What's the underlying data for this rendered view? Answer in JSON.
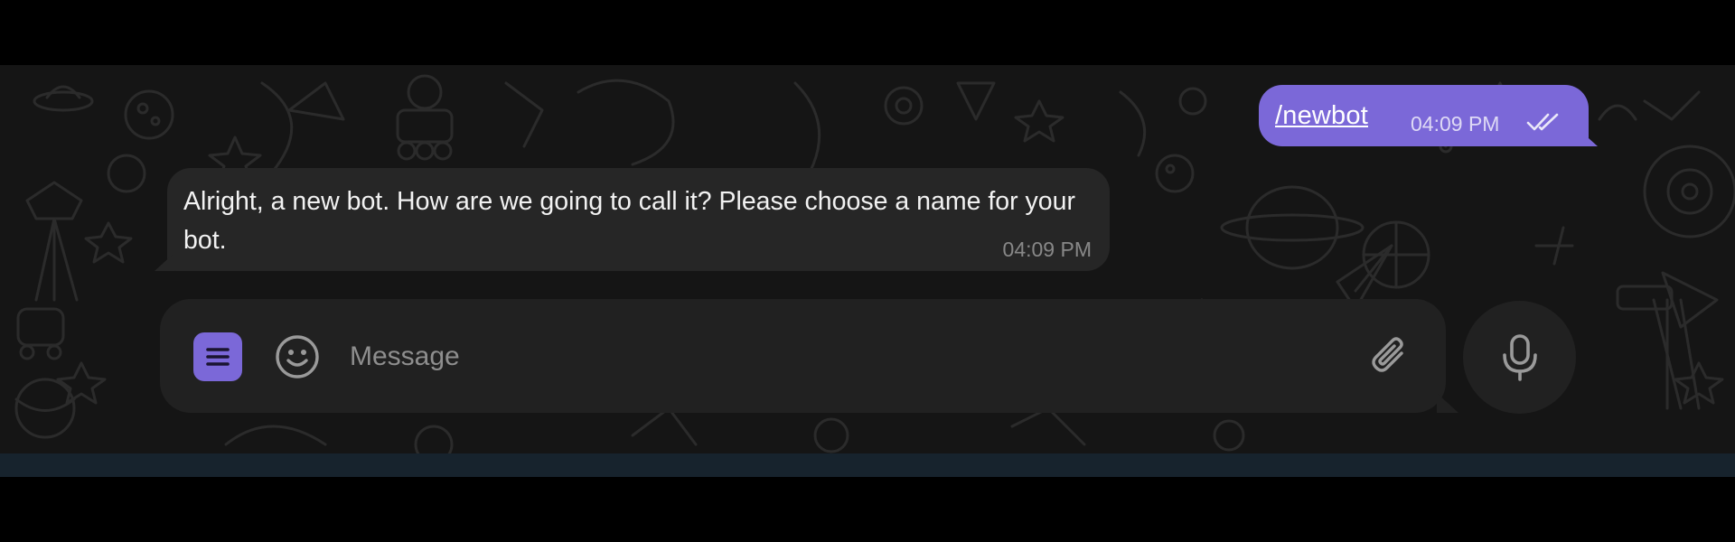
{
  "messages": [
    {
      "direction": "outgoing",
      "text": "/newbot",
      "time": "04:09 PM",
      "status_icon": "double-check-icon"
    },
    {
      "direction": "incoming",
      "text": "Alright, a new bot. How are we going to call it? Please choose a name for your bot.",
      "time": "04:09 PM"
    }
  ],
  "composer": {
    "placeholder": "Message",
    "menu_icon": "bot-menu-icon",
    "emoji_icon": "smiley-icon",
    "attach_icon": "paperclip-icon",
    "voice_icon": "microphone-icon"
  },
  "colors": {
    "accent": "#7b68d8",
    "chat_background": "#151515",
    "incoming_bubble": "#262626",
    "composer_background": "#212121"
  }
}
